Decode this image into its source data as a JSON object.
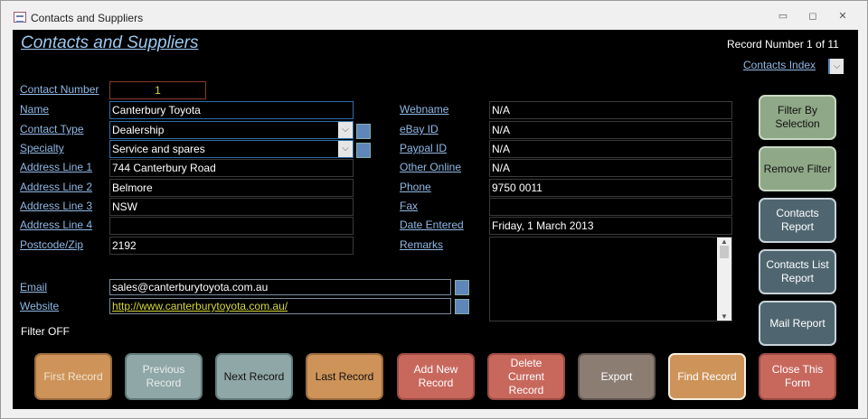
{
  "window": {
    "title": "Contacts and Suppliers",
    "min": "▭",
    "restore": "◻",
    "close": "✕"
  },
  "header": {
    "title": "Contacts and Suppliers",
    "record_number": "Record Number 1 of 11",
    "contacts_index": "Contacts Index"
  },
  "left_fields": [
    {
      "label": "Contact Number",
      "value": "1"
    },
    {
      "label": "Name",
      "value": "Canterbury Toyota"
    },
    {
      "label": "Contact Type",
      "value": "Dealership"
    },
    {
      "label": "Specialty",
      "value": "Service and spares"
    },
    {
      "label": "Address Line 1",
      "value": "744 Canterbury Road"
    },
    {
      "label": "Address Line 2",
      "value": "Belmore"
    },
    {
      "label": "Address Line 3",
      "value": "NSW"
    },
    {
      "label": "Address Line 4",
      "value": ""
    },
    {
      "label": "Postcode/Zip",
      "value": "2192"
    }
  ],
  "right_fields": [
    {
      "label": "Webname",
      "value": "N/A"
    },
    {
      "label": "eBay ID",
      "value": "N/A"
    },
    {
      "label": "Paypal ID",
      "value": "N/A"
    },
    {
      "label": "Other Online",
      "value": "N/A"
    },
    {
      "label": "Phone",
      "value": "9750 0011"
    },
    {
      "label": "Fax",
      "value": ""
    },
    {
      "label": "Date Entered",
      "value": "Friday, 1 March 2013"
    },
    {
      "label": "Remarks",
      "value": ""
    }
  ],
  "email": {
    "label": "Email",
    "value": "sales@canterburytoyota.com.au"
  },
  "website": {
    "label": "Website",
    "value": "http://www.canterburytoyota.com.au/"
  },
  "filter_status": "Filter OFF",
  "side_buttons": [
    "Filter By Selection",
    "Remove Filter",
    "Contacts Report",
    "Contacts List Report",
    "Mail Report"
  ],
  "nav_buttons": [
    "First Record",
    "Previous Record",
    "Next Record",
    "Last Record",
    "Add New Record",
    "Delete Current Record",
    "Export",
    "Find Record",
    "Close This Form"
  ],
  "colors": {
    "orange": "#cd9359",
    "teal": "#8fa7a6",
    "red": "#c8685d",
    "brown": "#8c7d73",
    "green": "#8fa887",
    "slate": "#4f6670"
  }
}
